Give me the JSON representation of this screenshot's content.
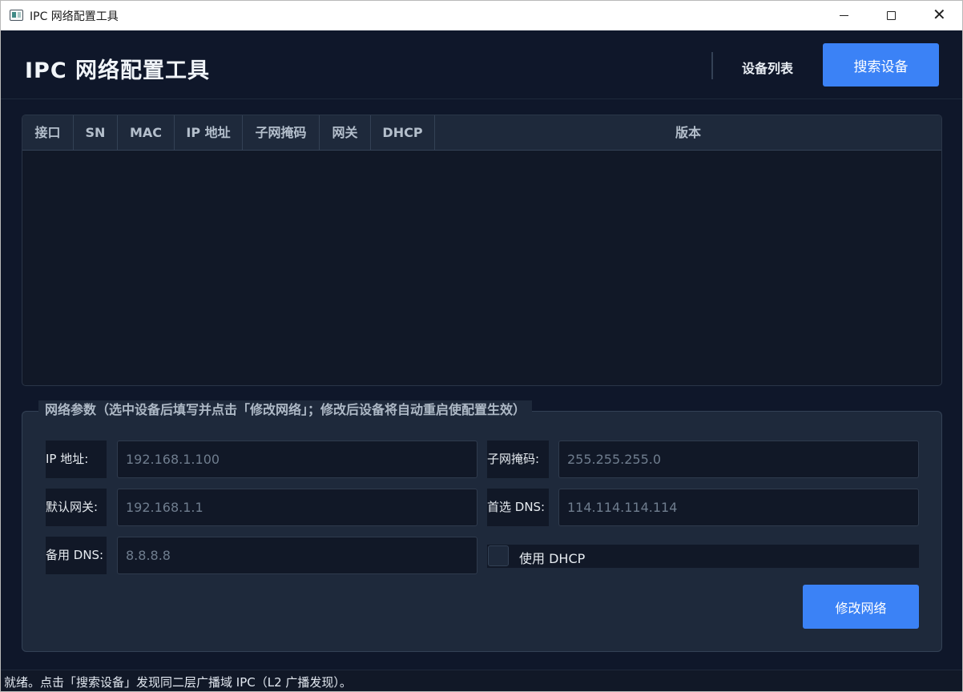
{
  "window": {
    "title": "IPC 网络配置工具"
  },
  "header": {
    "title": "IPC 网络配置工具",
    "device_list_label": "设备列表",
    "search_button_label": "搜索设备"
  },
  "table": {
    "columns": [
      "接口",
      "SN",
      "MAC",
      "IP 地址",
      "子网掩码",
      "网关",
      "DHCP",
      "版本"
    ],
    "rows": []
  },
  "network_params": {
    "legend": "网络参数（选中设备后填写并点击「修改网络」；修改后设备将自动重启使配置生效）",
    "ip_label": "IP 地址:",
    "ip_placeholder": "192.168.1.100",
    "subnet_label": "子网掩码:",
    "subnet_placeholder": "255.255.255.0",
    "gateway_label": "默认网关:",
    "gateway_placeholder": "192.168.1.1",
    "dns1_label": "首选 DNS:",
    "dns1_placeholder": "114.114.114.114",
    "dns2_label": "备用 DNS:",
    "dns2_placeholder": "8.8.8.8",
    "dhcp_label": "使用 DHCP",
    "dhcp_checked": false,
    "modify_button_label": "修改网络"
  },
  "status": {
    "text": "就绪。点击「搜索设备」发现同二层广播域 IPC（L2 广播发现）。"
  },
  "colors": {
    "accent": "#3b82f6",
    "background": "#0f172a",
    "panel": "#1e293b"
  }
}
